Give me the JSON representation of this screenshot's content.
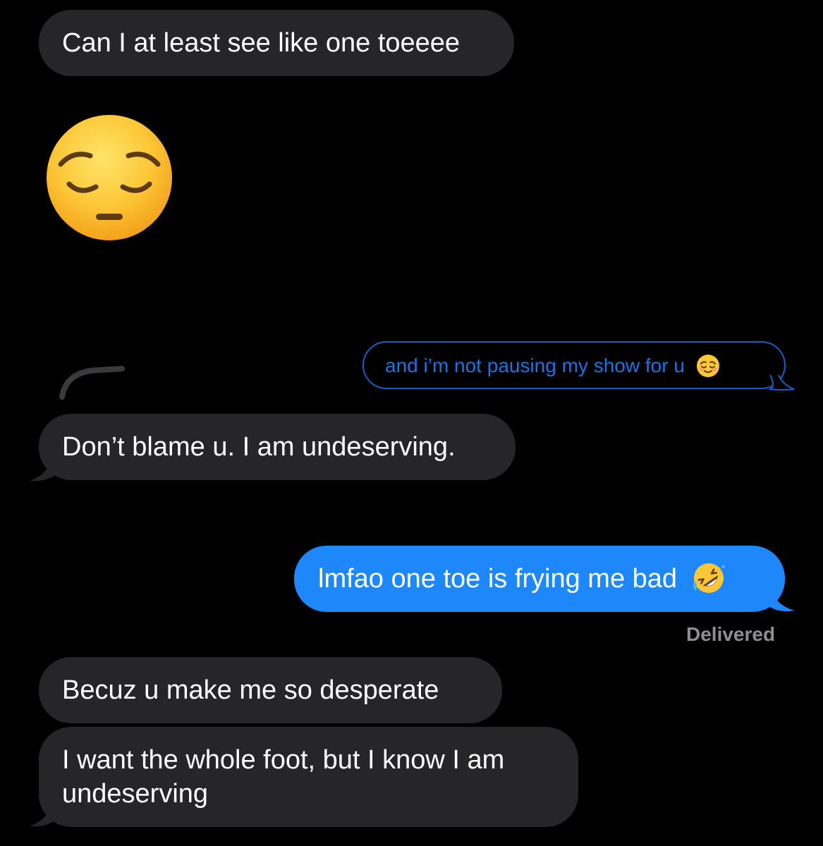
{
  "conversation": {
    "messages": [
      {
        "id": "m1",
        "sender": "them",
        "text": "Can I at least see like one toeeee"
      },
      {
        "id": "m2",
        "sender": "them",
        "type": "emoji",
        "emoji": "pensive-face"
      },
      {
        "id": "m3",
        "sender": "me",
        "type": "reply-quote",
        "text": "and i’m not pausing my show for u",
        "emoji": "relieved-face"
      },
      {
        "id": "m4",
        "sender": "them",
        "text": "Don’t blame u. I am undeserving."
      },
      {
        "id": "m5",
        "sender": "me",
        "text": "lmfao one toe is frying me bad",
        "emoji": "rolling-on-floor-laughing-face"
      },
      {
        "id": "m6",
        "sender": "them",
        "text": "Becuz u make me so desperate"
      },
      {
        "id": "m7",
        "sender": "them",
        "text_line1": "I want the whole foot, but I know I am",
        "text_line2": "undeserving"
      }
    ],
    "status": "Delivered"
  },
  "colors": {
    "background": "#000000",
    "incoming_bubble": "#262628",
    "outgoing_bubble": "#1e88fb",
    "outline_blue": "#1a5fc4",
    "status_text": "#8e8e93"
  }
}
